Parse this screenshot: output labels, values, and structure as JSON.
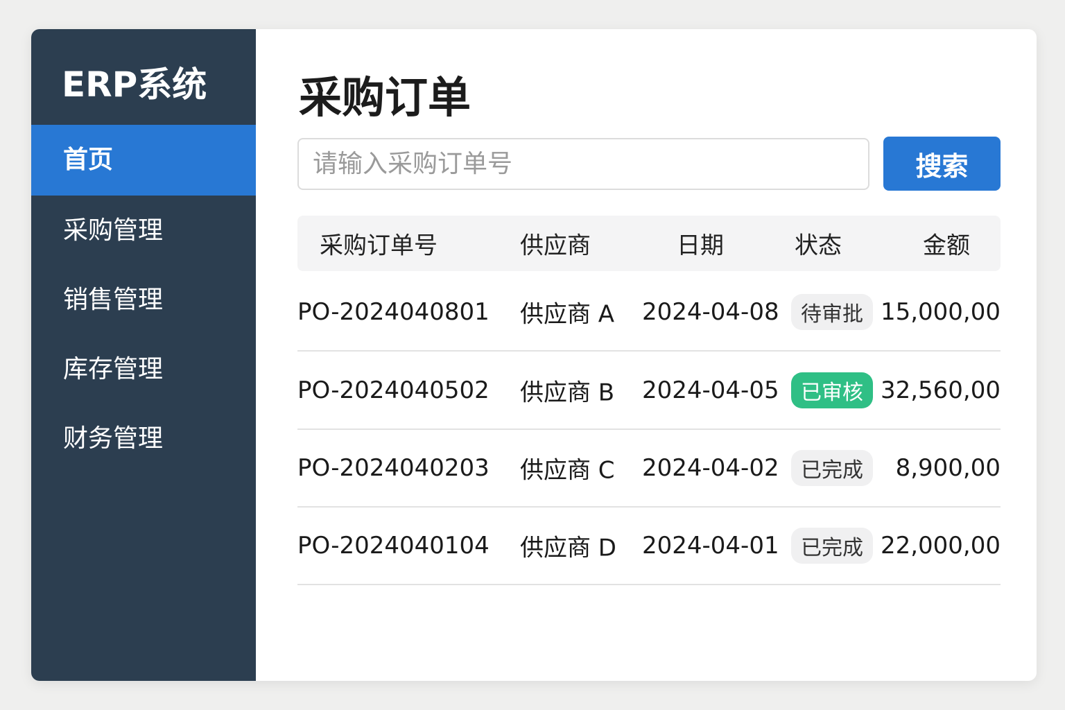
{
  "sidebar": {
    "logo": "ERP系统",
    "items": [
      {
        "label": "首页",
        "active": true
      },
      {
        "label": "采购管理"
      },
      {
        "label": "销售管理"
      },
      {
        "label": "库存管理"
      },
      {
        "label": "财务管理"
      }
    ]
  },
  "main": {
    "title": "采购订单",
    "search_placeholder": "请输入采购订单号",
    "search_button": "搜索",
    "columns": [
      "采购订单号",
      "供应商",
      "日期",
      "状态",
      "金额"
    ],
    "rows": [
      {
        "id": "PO-2024040801",
        "supplier": "供应商 A",
        "date": "2024-04-08",
        "status": "待审批",
        "amount": "15,000,00"
      },
      {
        "id": "PO-2024040502",
        "supplier": "供应商 B",
        "date": "2024-04-05",
        "status": "已审核",
        "amount": "32,560,00"
      },
      {
        "id": "PO-2024040203",
        "supplier": "供应商 C",
        "date": "2024-04-02",
        "status": "已完成",
        "amount": "8,900,00"
      },
      {
        "id": "PO-2024040104",
        "supplier": "供应商 D",
        "date": "2024-04-01",
        "status": "已完成",
        "amount": "22,000,00"
      }
    ]
  },
  "colors": {
    "sidebar": "#2c3e50",
    "accent": "#2878d4",
    "approved": "#2fbf85"
  }
}
